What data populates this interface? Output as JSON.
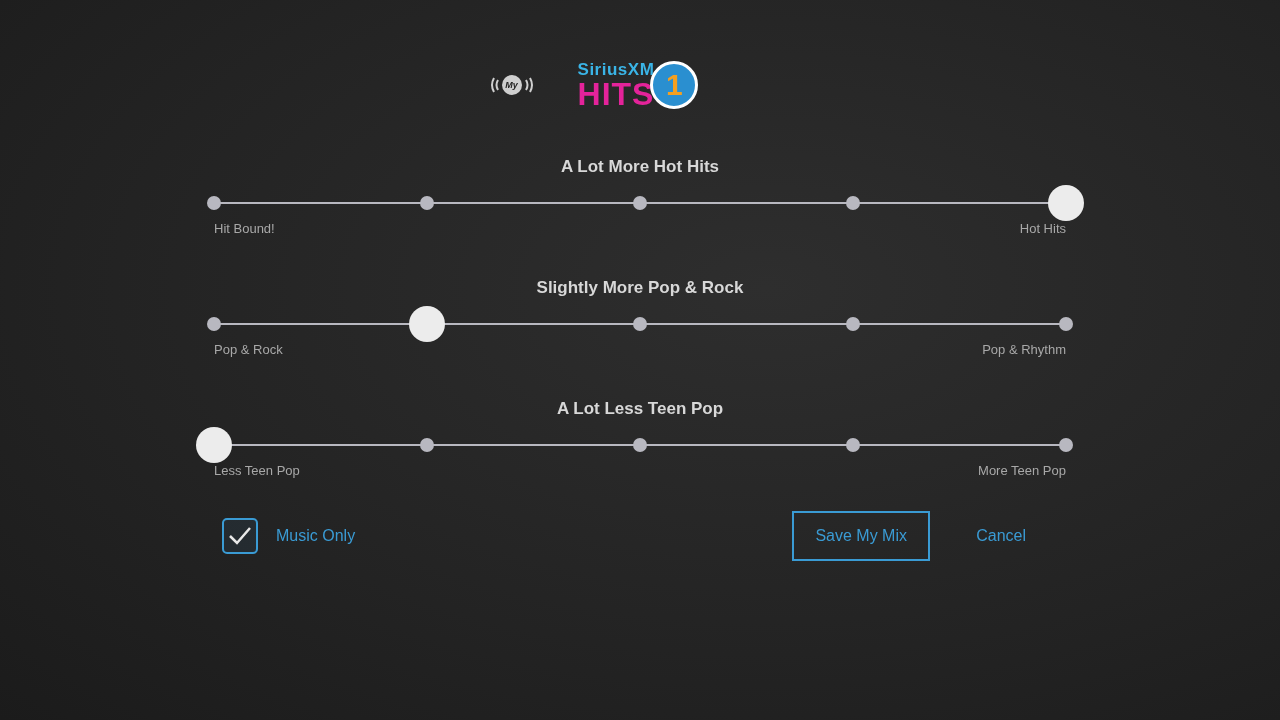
{
  "header": {
    "my_badge": "My",
    "logo": {
      "brand": "SiriusXM",
      "name": "HITS",
      "number": "1"
    }
  },
  "sliders": [
    {
      "title": "A Lot More Hot Hits",
      "left_label": "Hit Bound!",
      "right_label": "Hot Hits",
      "level": 1
    },
    {
      "title": "Slightly More Pop & Rock",
      "left_label": "Pop & Rock",
      "right_label": "Pop & Rhythm",
      "level": 0.25
    },
    {
      "title": "A Lot Less Teen Pop",
      "left_label": "Less Teen Pop",
      "right_label": "More Teen Pop",
      "level": 0
    }
  ],
  "music_only": {
    "label": "Music Only",
    "checked": true
  },
  "buttons": {
    "save": "Save My Mix",
    "cancel": "Cancel"
  }
}
